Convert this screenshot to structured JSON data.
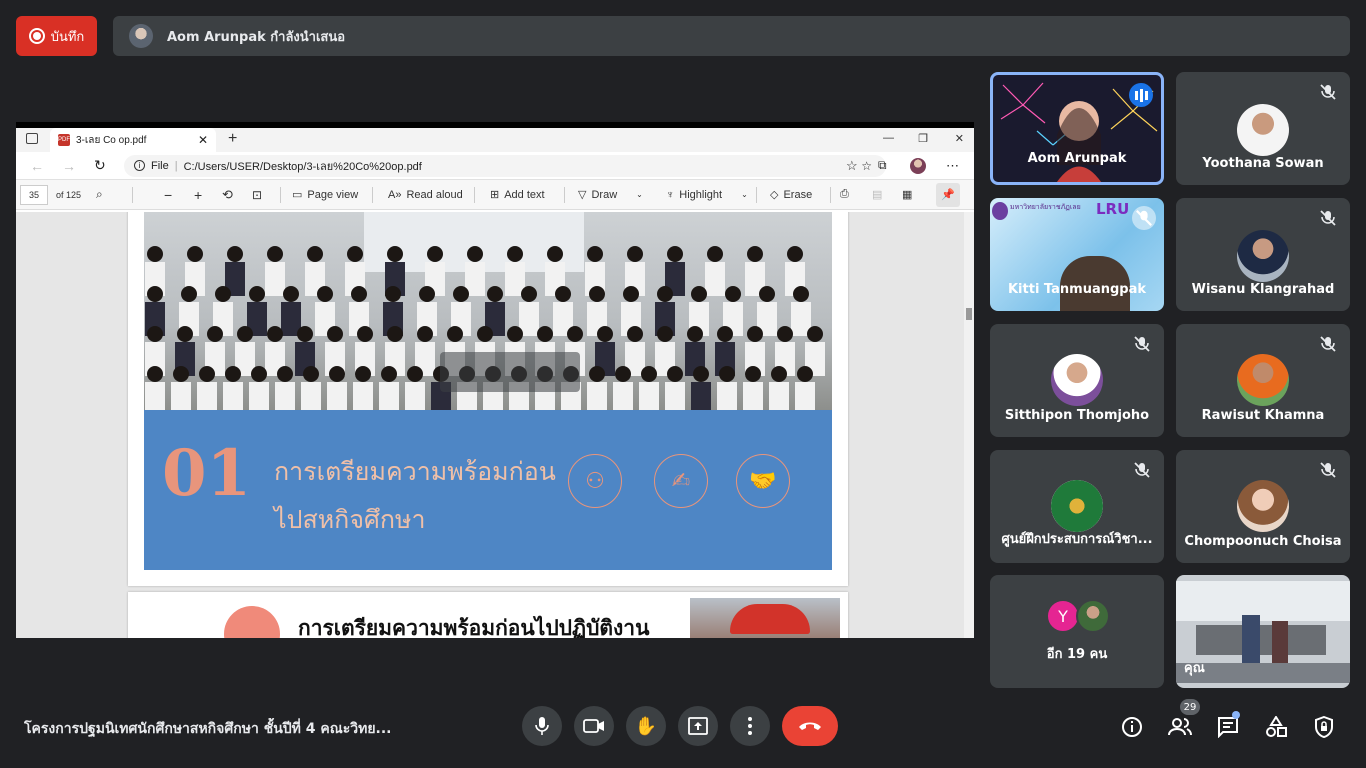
{
  "record": {
    "label": "บันทึก"
  },
  "presenter": {
    "text": "Aom Arunpak กำลังนำเสนอ"
  },
  "browser": {
    "tab_title": "3-เลย Co op.pdf",
    "file_label": "File",
    "url": "C:/Users/USER/Desktop/3-เลย%20Co%20op.pdf",
    "page_current": "35",
    "page_total": "of 125",
    "tools": {
      "page_view": "Page view",
      "read_aloud": "Read aloud",
      "add_text": "Add text",
      "draw": "Draw",
      "highlight": "Highlight",
      "erase": "Erase"
    }
  },
  "doc": {
    "section_number": "01",
    "section_title_line1": "การเตรียมความพร้อมก่อน",
    "section_title_line2": "ไปสหกิจศึกษา",
    "next_heading": "การเตรียมความพร้อมก่อนไปปฏิบัติงาน"
  },
  "participants": [
    {
      "name": "Aom Arunpak",
      "state": "speaking"
    },
    {
      "name": "Yoothana Sowan",
      "state": "muted"
    },
    {
      "name": "Kitti Tanmuangpak",
      "state": "muted"
    },
    {
      "name": "Wisanu Klangrahad",
      "state": "muted"
    },
    {
      "name": "Sitthipon Thomjoho",
      "state": "muted"
    },
    {
      "name": "Rawisut Khamna",
      "state": "muted"
    },
    {
      "name": "ศูนย์ฝึกประสบการณ์วิชา...",
      "state": "muted"
    },
    {
      "name": "Chompoonuch Choisa",
      "state": "muted"
    },
    {
      "name": "อีก 19 คน",
      "state": "others",
      "initial": "Y"
    },
    {
      "name": "คุณ",
      "state": "self"
    }
  ],
  "tile_badges": {
    "lru": "LRU",
    "lru_sub": "มหาวิทยาลัยราชภัฏเลย"
  },
  "meeting": {
    "title": "โครงการปฐมนิเทศนักศึกษาสหกิจศึกษา ชั้นปีที่ 4 คณะวิทย...",
    "people_count": "29"
  },
  "colors": {
    "bg": "#202124",
    "tile": "#3c4043",
    "accent": "#8ab4f8",
    "danger": "#ea4335",
    "record": "#d93025",
    "banner": "#4e86c5",
    "banner_text": "#e8957c"
  }
}
